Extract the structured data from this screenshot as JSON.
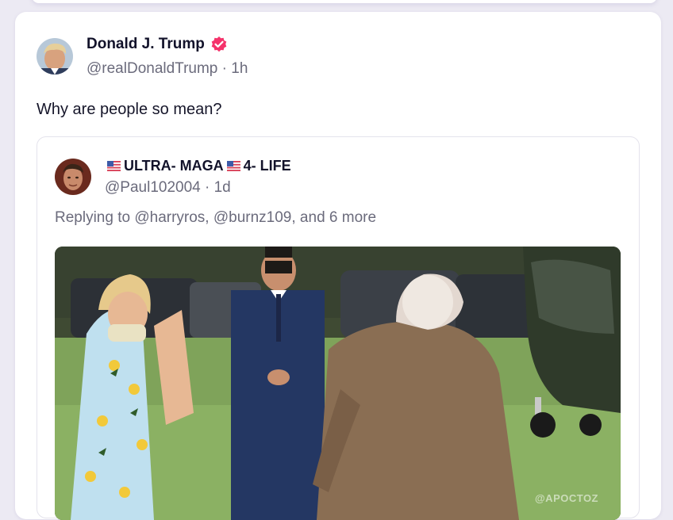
{
  "post": {
    "author_name": "Donald J. Trump",
    "handle": "@realDonaldTrump",
    "time": "1h",
    "text": "Why are people so mean?",
    "verified_color": "#f5336b"
  },
  "quote": {
    "name_part1": "ULTRA- MAGA",
    "name_part2": "4- LIFE",
    "handle": "@Paul102004",
    "time": "1d",
    "reply_text": "Replying to @harryros, @burnz109, and 6 more",
    "media_watermark": "@APOCTOZ"
  },
  "icons": {
    "verified": "verified-check-icon",
    "flag": "us-flag-icon"
  }
}
